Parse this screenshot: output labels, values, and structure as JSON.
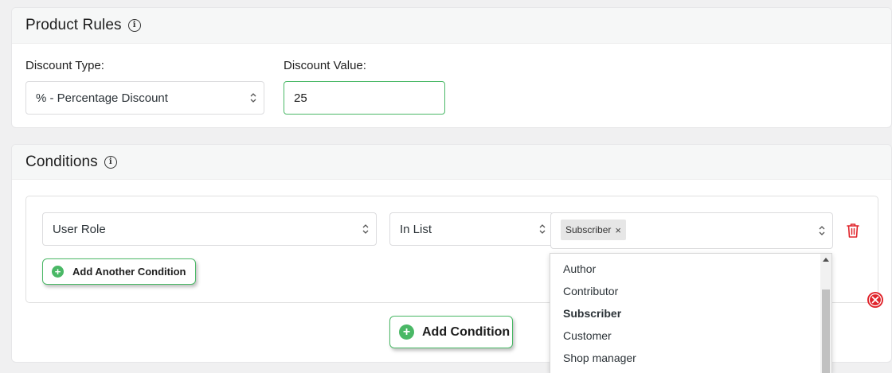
{
  "product_rules": {
    "title": "Product Rules",
    "discount_type_label": "Discount Type:",
    "discount_type_value": "% - Percentage Discount",
    "discount_value_label": "Discount Value:",
    "discount_value": "25"
  },
  "conditions": {
    "title": "Conditions",
    "field_value": "User Role",
    "operator_value": "In List",
    "selected_tags": [
      "Subscriber"
    ],
    "add_another_label": "Add Another Condition",
    "add_condition_label": "Add Condition",
    "dropdown_options": [
      {
        "label": "Author",
        "selected": false
      },
      {
        "label": "Contributor",
        "selected": false
      },
      {
        "label": "Subscriber",
        "selected": true
      },
      {
        "label": "Customer",
        "selected": false
      },
      {
        "label": "Shop manager",
        "selected": false
      }
    ]
  },
  "icons": {
    "info": "info-icon",
    "trash": "trash-icon",
    "remove": "close-circle-icon",
    "add": "plus-circle-icon",
    "select_arrows": "chevron-up-down-icon"
  },
  "colors": {
    "accent_green": "#4ab866",
    "danger_red": "#e0242b"
  }
}
